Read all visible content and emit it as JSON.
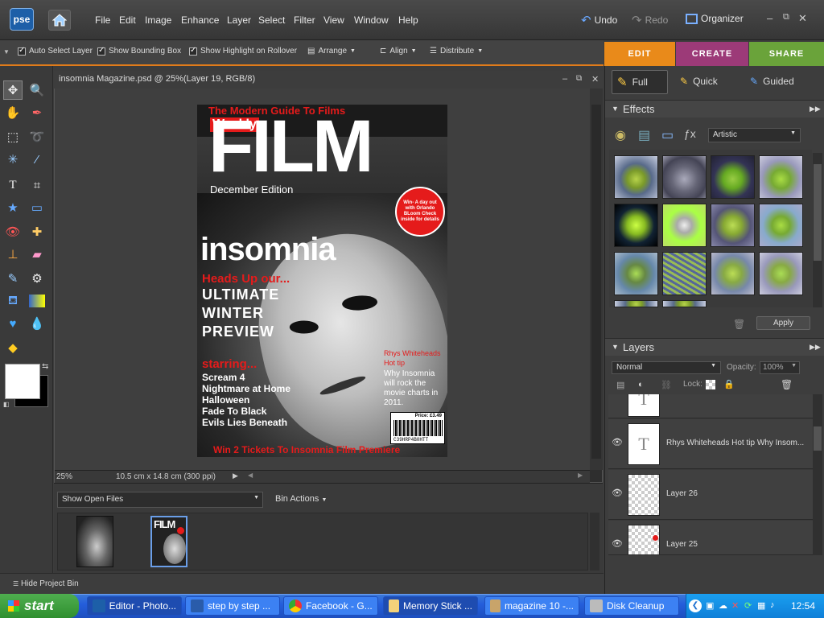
{
  "app": {
    "logo": "pse"
  },
  "menu": [
    "File",
    "Edit",
    "Image",
    "Enhance",
    "Layer",
    "Select",
    "Filter",
    "View",
    "Window",
    "Help"
  ],
  "top_actions": {
    "undo": "Undo",
    "redo": "Redo",
    "organizer": "Organizer"
  },
  "options": {
    "auto_select": "Auto Select Layer",
    "bounding_box": "Show Bounding Box",
    "highlight": "Show Highlight on Rollover",
    "arrange": "Arrange",
    "align": "Align",
    "distribute": "Distribute"
  },
  "mode_tabs": [
    {
      "label": "EDIT",
      "color": "#e98a1a"
    },
    {
      "label": "CREATE",
      "color": "#9c3a78"
    },
    {
      "label": "SHARE",
      "color": "#6aa33a"
    }
  ],
  "edit_modes": [
    "Full",
    "Quick",
    "Guided"
  ],
  "document": {
    "title": "insomnia Magazine.psd @ 25%(Layer 19, RGB/8)",
    "zoom": "25%",
    "size": "10.5 cm x 14.8 cm (300 ppi)"
  },
  "magazine": {
    "tagline": "The Modern Guide To Films",
    "weekly": "Weekly",
    "masthead": "FILM",
    "edition": "December Edition",
    "badge": "Win- A day out with Orlando BLoom Check inside for details",
    "brand": "insomnia",
    "headline_red": "Heads Up our...",
    "headline_lines": [
      "ULTIMATE",
      "WINTER",
      "PREVIEW"
    ],
    "starring": "starring...",
    "films": [
      "Scream 4",
      "Nightmare at Home",
      "Halloween",
      "Fade To Black",
      "Evils Lies Beneath"
    ],
    "side_red": "Rhys Whiteheads Hot tip",
    "side_white": "Why Insomnia will rock the movie charts in 2011.",
    "price": "Price: £3.49",
    "barcode": "C39HRP4B0HTT",
    "footer": "Win 2 Tickets To Insomnia Film Premiere"
  },
  "bin": {
    "show": "Show Open Files",
    "actions": "Bin Actions",
    "hide": "Hide Project Bin"
  },
  "effects": {
    "title": "Effects",
    "category": "Artistic",
    "apply": "Apply"
  },
  "layers": {
    "title": "Layers",
    "blend": "Normal",
    "opacity_label": "Opacity:",
    "opacity": "100%",
    "lock": "Lock:",
    "items": [
      {
        "name": "Rhys Whiteheads Hot tip Why Insom...",
        "type": "text"
      },
      {
        "name": "Layer 26",
        "type": "pixel"
      },
      {
        "name": "Layer 25",
        "type": "pixel"
      }
    ]
  },
  "taskbar": {
    "start": "start",
    "items": [
      "Editor - Photo...",
      "step by step ...",
      "Facebook - G...",
      "Memory Stick ...",
      "magazine 10 -...",
      "Disk Cleanup"
    ],
    "clock": "12:54"
  }
}
